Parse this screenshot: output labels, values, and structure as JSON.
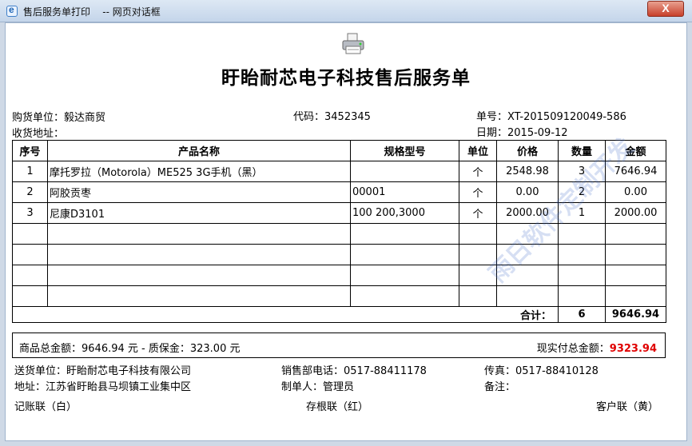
{
  "window": {
    "title": "售后服务单打印    -- 网页对话框",
    "close_label": "X"
  },
  "doc": {
    "title": "盱眙耐芯电子科技售后服务单"
  },
  "header": {
    "buyer": "购货单位：毅达商贸",
    "code": "代码：3452345",
    "order_no": "单号：XT-201509120049-586",
    "address": "收货地址：",
    "date": "日期：2015-09-12"
  },
  "table": {
    "columns": [
      "序号",
      "产品名称",
      "规格型号",
      "单位",
      "价格",
      "数量",
      "金额"
    ],
    "rows": [
      [
        "1",
        "摩托罗拉（Motorola）ME525 3G手机（黑）",
        "",
        "个",
        "2548.98",
        "3",
        "7646.94"
      ],
      [
        "2",
        "阿胶贡枣",
        "00001",
        "个",
        "0.00",
        "2",
        "0.00"
      ],
      [
        "3",
        "尼康D3101",
        "100 200,3000",
        "个",
        "2000.00",
        "1",
        "2000.00"
      ],
      [
        "",
        "",
        "",
        "",
        "",
        "",
        ""
      ],
      [
        "",
        "",
        "",
        "",
        "",
        "",
        ""
      ],
      [
        "",
        "",
        "",
        "",
        "",
        "",
        ""
      ],
      [
        "",
        "",
        "",
        "",
        "",
        "",
        ""
      ]
    ],
    "total_label": "合计：",
    "total_qty": "6",
    "total_amount": "9646.94"
  },
  "summary": {
    "left": "商品总金额：9646.94 元 - 质保金：323.00 元",
    "right_label": "现实付总金额：",
    "right_value": "9323.94"
  },
  "footer": {
    "sender": "送货单位：盱眙耐芯电子科技有限公司",
    "sales_phone": "销售部电话：0517-88411178",
    "fax": "传真：0517-88410128",
    "addr": "地址：江苏省盱眙县马坝镇工业集中区",
    "maker": "制单人：管理员",
    "remark": "备注：",
    "copy1": "记账联（白）",
    "copy2": "存根联（红）",
    "copy3": "客户联（黄）"
  },
  "watermark": "雨日软件定制开发",
  "colors": {
    "accent_red": "#e00000",
    "titlebar": "#c4d5ea"
  }
}
